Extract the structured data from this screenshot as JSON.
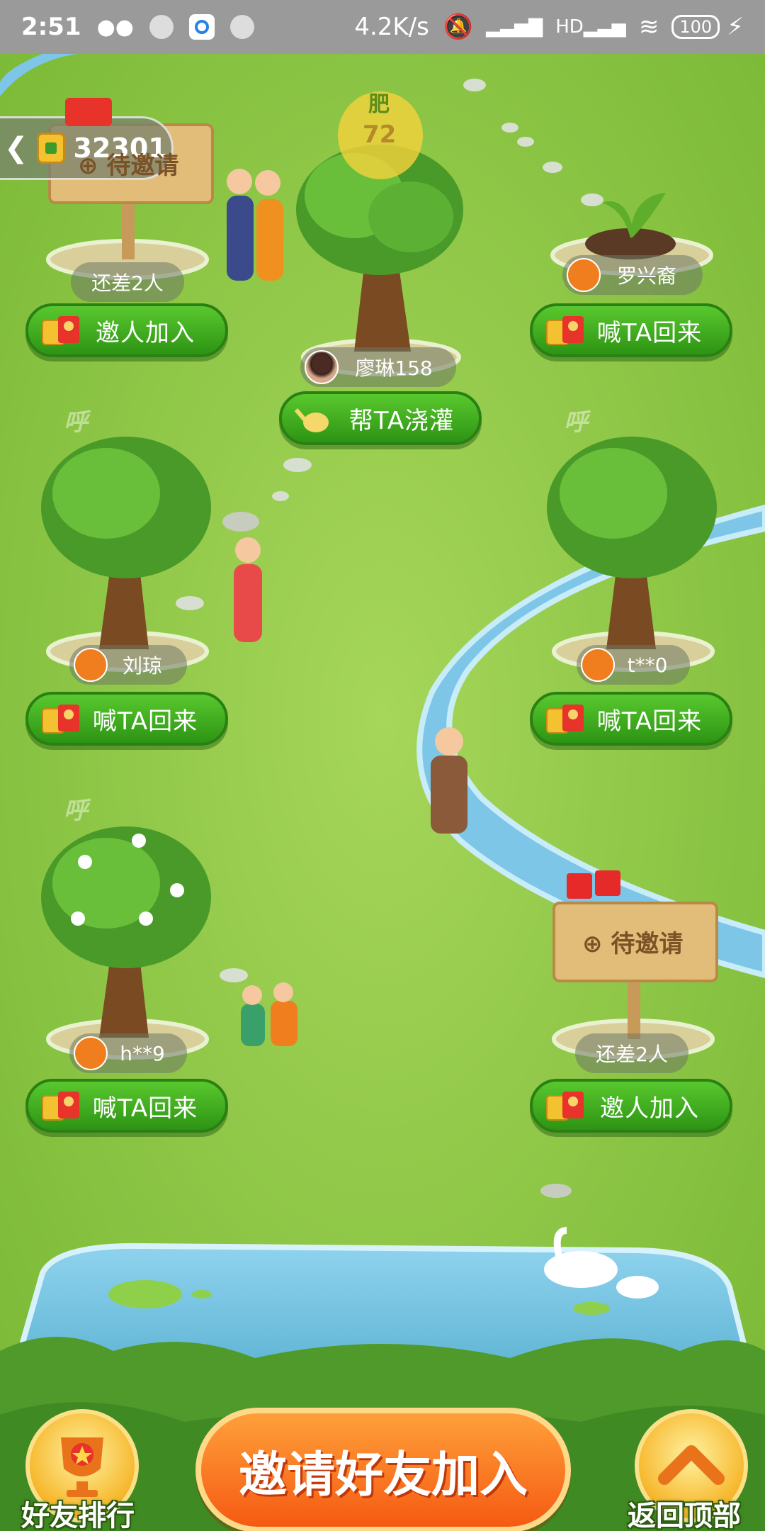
{
  "status_bar": {
    "time": "2:51",
    "net_speed": "4.2K/s",
    "battery": "100",
    "signal_label": "HD"
  },
  "header": {
    "coins": "32301"
  },
  "fertilizer": {
    "label": "肥",
    "value": "72"
  },
  "plots": [
    {
      "id": "invite-1",
      "type": "sign",
      "sign_label": "待邀请",
      "caption": "还差2人",
      "button": "邀人加入"
    },
    {
      "id": "center-tree",
      "type": "tree",
      "name": "廖琳158",
      "button": "帮TA浇灌"
    },
    {
      "id": "sprout",
      "type": "sprout",
      "name": "罗兴裔",
      "button": "喊TA回来"
    },
    {
      "id": "tree-left-2",
      "type": "tree",
      "name": "刘琼",
      "button": "喊TA回来"
    },
    {
      "id": "tree-right-2",
      "type": "tree",
      "name": "t**0",
      "button": "喊TA回来"
    },
    {
      "id": "tree-left-3",
      "type": "tree",
      "name": "h**9",
      "button": "喊TA回来"
    },
    {
      "id": "invite-2",
      "type": "sign",
      "sign_label": "待邀请",
      "caption": "还差2人",
      "button": "邀人加入"
    }
  ],
  "sleep_marks": [
    "呼",
    "呼",
    "呼"
  ],
  "bottom": {
    "ranking_label": "好友排行",
    "invite_label": "邀请好友加入",
    "top_label": "返回顶部"
  },
  "colors": {
    "grass": "#8cc63f",
    "button_green": "#3aa81c",
    "invite_orange": "#f5731c",
    "river": "#7dc6e8"
  }
}
